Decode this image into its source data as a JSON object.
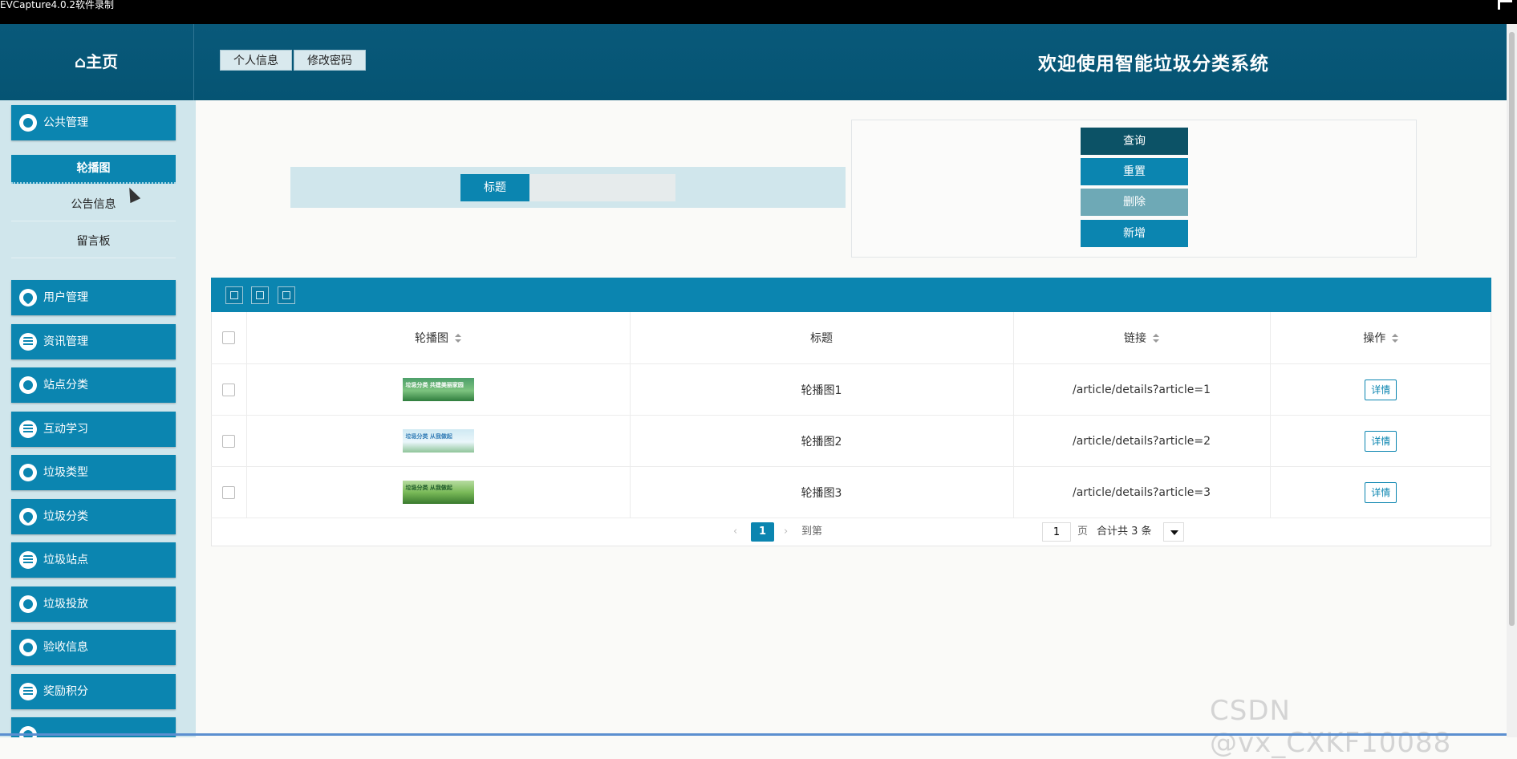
{
  "capture_bar": {
    "title": "EVCapture4.0.2软件录制"
  },
  "header": {
    "home_label": "⌂主页",
    "tabs": [
      {
        "label": "个人信息"
      },
      {
        "label": "修改密码"
      }
    ],
    "app_title": "欢迎使用智能垃圾分类系统"
  },
  "sidebar": {
    "groups": [
      {
        "label": "公共管理",
        "icon": "chat-icon"
      },
      {
        "label": "用户管理",
        "icon": "heart-icon"
      },
      {
        "label": "资讯管理",
        "icon": "list-icon"
      },
      {
        "label": "站点分类",
        "icon": "gear-icon"
      },
      {
        "label": "互动学习",
        "icon": "list-icon"
      },
      {
        "label": "垃圾类型",
        "icon": "chat-icon"
      },
      {
        "label": "垃圾分类",
        "icon": "heart-icon"
      },
      {
        "label": "垃圾站点",
        "icon": "list-icon"
      },
      {
        "label": "垃圾投放",
        "icon": "gear-icon"
      },
      {
        "label": "验收信息",
        "icon": "chat-icon"
      },
      {
        "label": "奖励积分",
        "icon": "list-icon"
      }
    ],
    "sub_items": [
      {
        "label": "轮播图",
        "active": true
      },
      {
        "label": "公告信息",
        "active": false
      },
      {
        "label": "留言板",
        "active": false
      }
    ]
  },
  "search": {
    "label": "标题",
    "value": ""
  },
  "actions": {
    "query": "查询",
    "reset": "重置",
    "delete": "删除",
    "add": "新增",
    "colors": {
      "query": "#0c5266",
      "reset": "#0b85b0",
      "delete": "#6ea9b6",
      "add": "#0b85b0"
    }
  },
  "table": {
    "headers": {
      "image": "轮播图",
      "title": "标题",
      "link": "链接",
      "ops": "操作"
    },
    "rows": [
      {
        "image_caption": "垃圾分类 共建美丽家园",
        "title": "轮播图1",
        "link": "/article/details?article=1",
        "action": "详情"
      },
      {
        "image_caption": "垃圾分类 从我做起",
        "title": "轮播图2",
        "link": "/article/details?article=2",
        "action": "详情"
      },
      {
        "image_caption": "垃圾分类 从我做起",
        "title": "轮播图3",
        "link": "/article/details?article=3",
        "action": "详情"
      }
    ]
  },
  "pager": {
    "current": "1",
    "goto_label": "到第",
    "goto_value": "1",
    "page_label": "页",
    "total_text": "合计共 3 条"
  },
  "watermark": "CSDN @vx_CXKF10088"
}
